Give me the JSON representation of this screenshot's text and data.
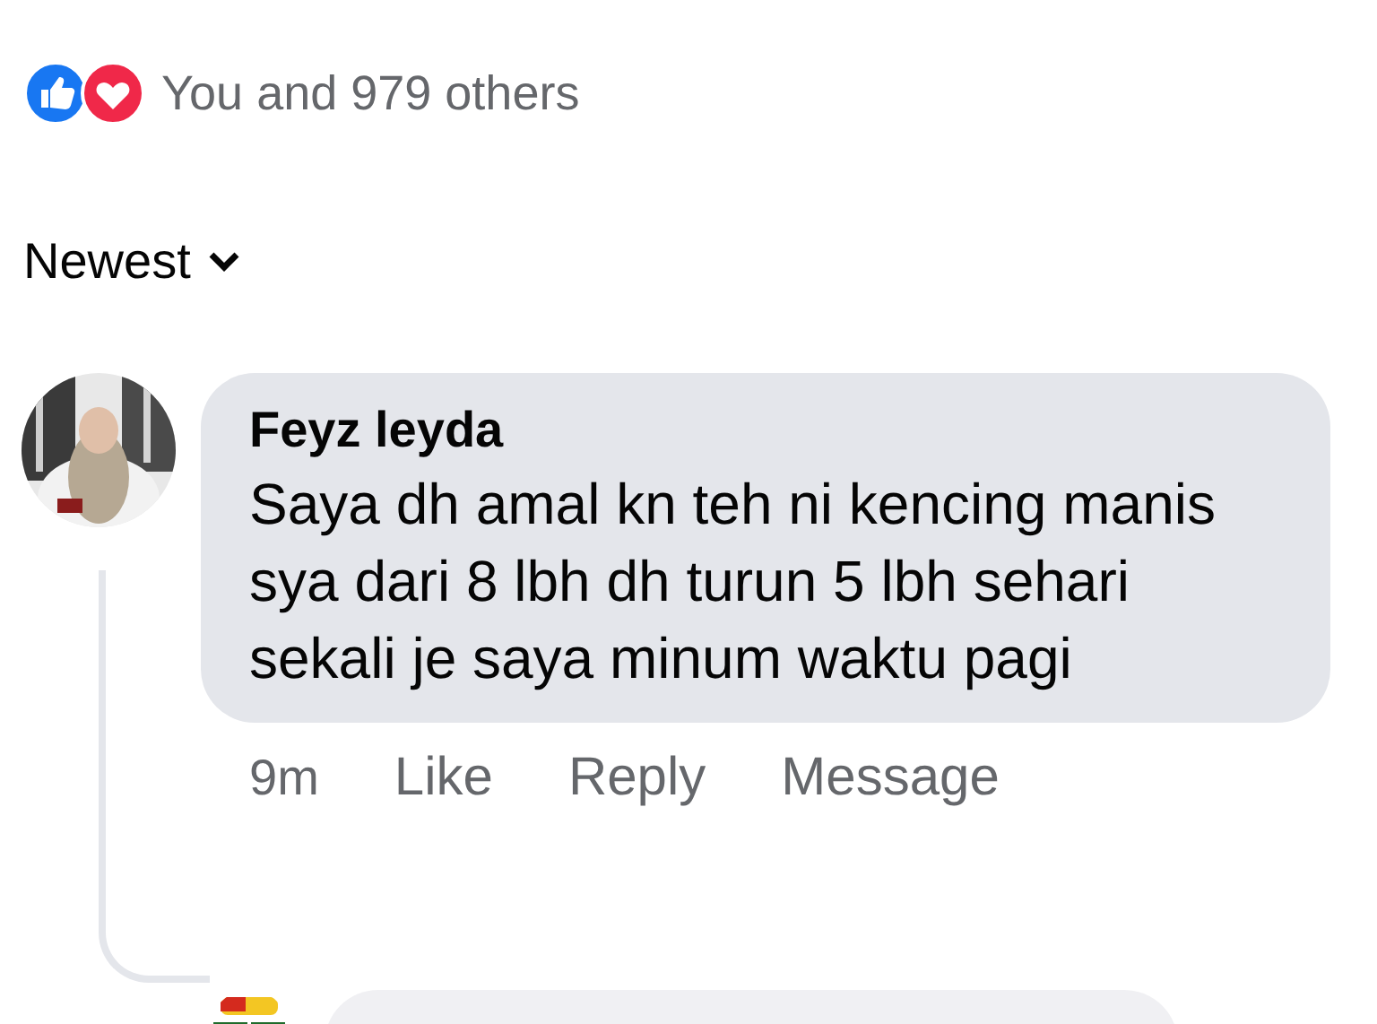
{
  "reactions": {
    "summary": "You and 979 others"
  },
  "sort": {
    "label": "Newest"
  },
  "comments": [
    {
      "author": "Feyz leyda",
      "text": "Saya dh amal kn teh ni kencing manis sya dari 8 lbh dh turun 5 lbh sehari sekali je saya minum waktu pagi",
      "time": "9m",
      "actions": [
        "Like",
        "Reply",
        "Message"
      ]
    }
  ]
}
